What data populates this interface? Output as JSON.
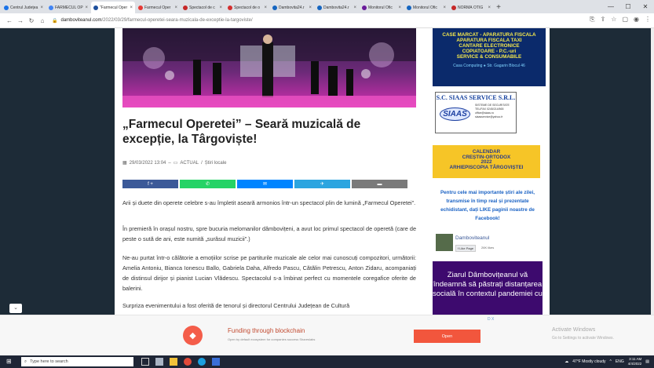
{
  "browser": {
    "tabs": [
      {
        "label": "Centrul Județea",
        "color": "#1a73e8",
        "active": false
      },
      {
        "label": "FARMECUL OPE",
        "color": "#4285f4",
        "active": false
      },
      {
        "label": "\"Farmecul Oper",
        "color": "#1d4f9c",
        "active": true
      },
      {
        "label": "Farmecul Oper",
        "color": "#e53935",
        "active": false
      },
      {
        "label": "Spectacol de c",
        "color": "#c62828",
        "active": false
      },
      {
        "label": "Spectacol de o",
        "color": "#d32f2f",
        "active": false
      },
      {
        "label": "Dambovita24.r",
        "color": "#1565c0",
        "active": false
      },
      {
        "label": "Dambovita24.r",
        "color": "#1565c0",
        "active": false
      },
      {
        "label": "Monitorul Ofic",
        "color": "#6a1b9a",
        "active": false
      },
      {
        "label": "Monitorul Ofic",
        "color": "#1565c0",
        "active": false
      },
      {
        "label": "NORMĂ OTIG",
        "color": "#c62828",
        "active": false
      }
    ],
    "close_glyph": "×",
    "new_tab_glyph": "+",
    "url_host": "damboviteanul.com",
    "url_path": "/2022/03/29/farmecul-operetei-seara-muzicala-de-exceptie-la-targoviste/"
  },
  "article": {
    "title": "„Farmecul Operetei” – Seară muzicală de excepție, la Târgoviște!",
    "date": "29/03/2022 13:04",
    "separator": "–",
    "category": "ACTUAL",
    "subcategory": "Știri locale",
    "share_buttons": [
      {
        "label": "f  +",
        "color": "#3b5998"
      },
      {
        "label": "✆",
        "color": "#25d366"
      },
      {
        "label": "✉",
        "color": "#0084ff"
      },
      {
        "label": "✈",
        "color": "#2ca5e0"
      },
      {
        "label": "▬",
        "color": "#7a7a7a"
      }
    ],
    "paragraphs": [
      "Arii și duete din operete celebre s-au împletit aseară armonios într-un spectacol plin de lumină „Farmecul Operetei”.",
      "În premieră în orașul nostru, spre bucuria melomanilor dâmbovițeni, a avut loc primul spectacol de operetă (care de peste o sută de ani, este numită „surâsul muzicii”.)",
      "Ne-au purtat într-o călătorie a emoțiilor scrise pe partiturile muzicale ale celor mai cunoscuți compozitori, următorii: Amelia Antoniu, Bianca Ionescu Ballo, Gabriela Daha, Alfredo Pascu, Cătălin Petrescu, Anton Zidaru, acompaniați de distinsul dirijor și pianist Lucian Vlădescu. Spectacolul s-a îmbinat perfect cu momentele coregafice oferite de balerini.",
      "Surpriza evenimentului a fost oferită de tenorul și directorul Centrului Județean de Cultură"
    ]
  },
  "sidebar": {
    "ad_casemarcat": [
      "CASE MARCAT - APARATURA FISCALA",
      "APARATURA FISCALA TAXI",
      "CANTARE ELECTRONICE",
      "COPIATOARE - P.C.-uri",
      "SERVICE & CONSUMABILE"
    ],
    "ad_casemarcat_sub": "Casa Computing ● Str. Gagarin Blocul 46",
    "siaas": {
      "title": "S.C. SIAAS SERVICE S.R.L.",
      "logo": "SIAAS",
      "info": [
        "SISTEME DE SECURITATE",
        "TEL/FAX 0245/214/565",
        "office@siaas.ro",
        "siaasservice@yahoo.fr"
      ]
    },
    "calendar": [
      "CALENDAR",
      "CREȘTIN-ORTODOX",
      "2022",
      "ARHIEPISCOPIA TÂRGOVIȘTEI"
    ],
    "facebook_text": "Pentru cele mai importante știri ale zilei, transmise în timp real și prezentate echidistant, dați LIKE paginii noastre de Facebook!",
    "facebook_box": {
      "name": "Damboviteanul",
      "like": "Like Page",
      "count": "26K likes"
    },
    "purple_text": "Ziarul Dâmbovițeanul vă îndeamnă să păstrați distanțarea socială în contextul pandemiei cu"
  },
  "ad": {
    "headline": "Funding through blockchain",
    "sub": "Open by default ecosystem for companies success Shareslabs",
    "button": "Open",
    "adchoices": "D X",
    "activate_title": "Activate Windows",
    "activate_sub": "Go to Settings to activate Windows."
  },
  "taskbar": {
    "search_placeholder": "Type here to search",
    "weather": "47°F  Mostly cloudy",
    "lang": "ENG",
    "time": "3:11 AM",
    "date": "4/4/2022"
  }
}
